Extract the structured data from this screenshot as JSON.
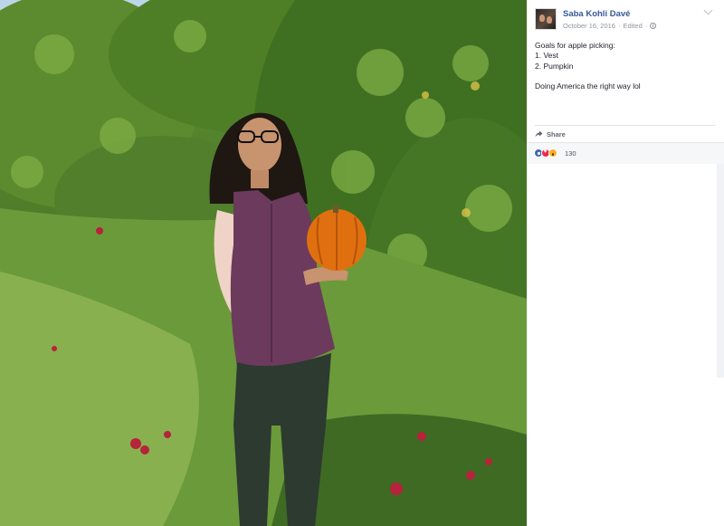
{
  "post": {
    "author": "Saba Kohli Davé",
    "date": "October 16, 2016",
    "edited": "Edited",
    "separator": "·",
    "text_lines": [
      "Goals for apple picking:",
      "1. Vest",
      "2. Pumpkin"
    ],
    "text_extra": "Doing America the right way lol"
  },
  "actions": {
    "share_label": "Share"
  },
  "reactions": {
    "count": "130",
    "types": [
      "like-icon",
      "love-icon",
      "wow-icon"
    ]
  },
  "colors": {
    "link_blue": "#365899",
    "meta_gray": "#90949c",
    "pumpkin": "#e0700f",
    "vest": "#6c3a5c",
    "foliage": "#4f7d2a"
  }
}
